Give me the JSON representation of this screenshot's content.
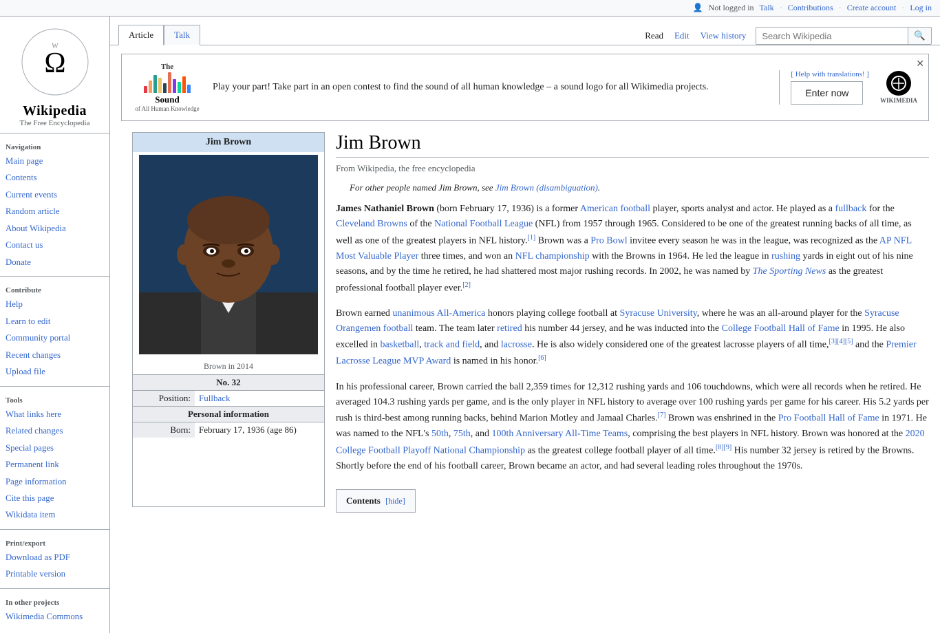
{
  "header": {
    "user_status": "Not logged in",
    "links": [
      "Talk",
      "Contributions",
      "Create account",
      "Log in"
    ]
  },
  "search": {
    "placeholder": "Search Wikipedia"
  },
  "tabs": {
    "left": [
      {
        "label": "Article",
        "active": true
      },
      {
        "label": "Talk",
        "active": false
      }
    ],
    "right": [
      {
        "label": "Read",
        "active": true
      },
      {
        "label": "Edit",
        "active": false
      },
      {
        "label": "View history",
        "active": false
      }
    ]
  },
  "banner": {
    "help_text": "[ Help with translations! ]",
    "text": "Play your part! Take part in an open contest to find the sound of all human knowledge – a sound logo for all Wikimedia projects.",
    "button_label": "Enter now",
    "wikimedia_label": "WIKIMEDIA"
  },
  "sidebar": {
    "logo_title": "Wikipedia",
    "logo_sub": "The Free Encyclopedia",
    "navigation_title": "Navigation",
    "nav_items": [
      {
        "label": "Main page",
        "href": "#"
      },
      {
        "label": "Contents",
        "href": "#"
      },
      {
        "label": "Current events",
        "href": "#"
      },
      {
        "label": "Random article",
        "href": "#"
      },
      {
        "label": "About Wikipedia",
        "href": "#"
      },
      {
        "label": "Contact us",
        "href": "#"
      },
      {
        "label": "Donate",
        "href": "#"
      }
    ],
    "contribute_title": "Contribute",
    "contribute_items": [
      {
        "label": "Help",
        "href": "#"
      },
      {
        "label": "Learn to edit",
        "href": "#"
      },
      {
        "label": "Community portal",
        "href": "#"
      },
      {
        "label": "Recent changes",
        "href": "#"
      },
      {
        "label": "Upload file",
        "href": "#"
      }
    ],
    "tools_title": "Tools",
    "tools_items": [
      {
        "label": "What links here",
        "href": "#"
      },
      {
        "label": "Related changes",
        "href": "#"
      },
      {
        "label": "Special pages",
        "href": "#"
      },
      {
        "label": "Permanent link",
        "href": "#"
      },
      {
        "label": "Page information",
        "href": "#"
      },
      {
        "label": "Cite this page",
        "href": "#"
      },
      {
        "label": "Wikidata item",
        "href": "#"
      }
    ],
    "print_title": "Print/export",
    "print_items": [
      {
        "label": "Download as PDF",
        "href": "#"
      },
      {
        "label": "Printable version",
        "href": "#"
      }
    ],
    "other_title": "In other projects",
    "other_items": [
      {
        "label": "Wikimedia Commons",
        "href": "#"
      }
    ]
  },
  "article": {
    "title": "Jim Brown",
    "from_wiki": "From Wikipedia, the free encyclopedia",
    "italic_note": "For other people named Jim Brown, see Jim Brown (disambiguation).",
    "paragraphs": [
      "James Nathaniel Brown (born February 17, 1936) is a former American football player, sports analyst and actor. He played as a fullback for the Cleveland Browns of the National Football League (NFL) from 1957 through 1965. Considered to be one of the greatest running backs of all time, as well as one of the greatest players in NFL history.[1] Brown was a Pro Bowl invitee every season he was in the league, was recognized as the AP NFL Most Valuable Player three times, and won an NFL championship with the Browns in 1964. He led the league in rushing yards in eight out of his nine seasons, and by the time he retired, he had shattered most major rushing records. In 2002, he was named by The Sporting News as the greatest professional football player ever.[2]",
      "Brown earned unanimous All-America honors playing college football at Syracuse University, where he was an all-around player for the Syracuse Orangemen football team. The team later retired his number 44 jersey, and he was inducted into the College Football Hall of Fame in 1995. He also excelled in basketball, track and field, and lacrosse. He is also widely considered one of the greatest lacrosse players of all time,[3][4][5] and the Premier Lacrosse League MVP Award is named in his honor.[6]",
      "In his professional career, Brown carried the ball 2,359 times for 12,312 rushing yards and 106 touchdowns, which were all records when he retired. He averaged 104.3 rushing yards per game, and is the only player in NFL history to average over 100 rushing yards per game for his career. His 5.2 yards per rush is third-best among running backs, behind Marion Motley and Jamaal Charles.[7] Brown was enshrined in the Pro Football Hall of Fame in 1971. He was named to the NFL's 50th, 75th, and 100th Anniversary All-Time Teams, comprising the best players in NFL history. Brown was honored at the 2020 College Football Playoff National Championship as the greatest college football player of all time.[8][9] His number 32 jersey is retired by the Browns. Shortly before the end of his football career, Brown became an actor, and had several leading roles throughout the 1970s."
    ],
    "contents_title": "Contents",
    "contents_hide": "[hide]"
  },
  "infobox": {
    "title": "Jim Brown",
    "caption": "Brown in 2014",
    "number": "No. 32",
    "position_label": "Position:",
    "position_value": "Fullback",
    "personal_info": "Personal information",
    "born_label": "Born:",
    "born_value": "February 17, 1936 (age 86)"
  }
}
